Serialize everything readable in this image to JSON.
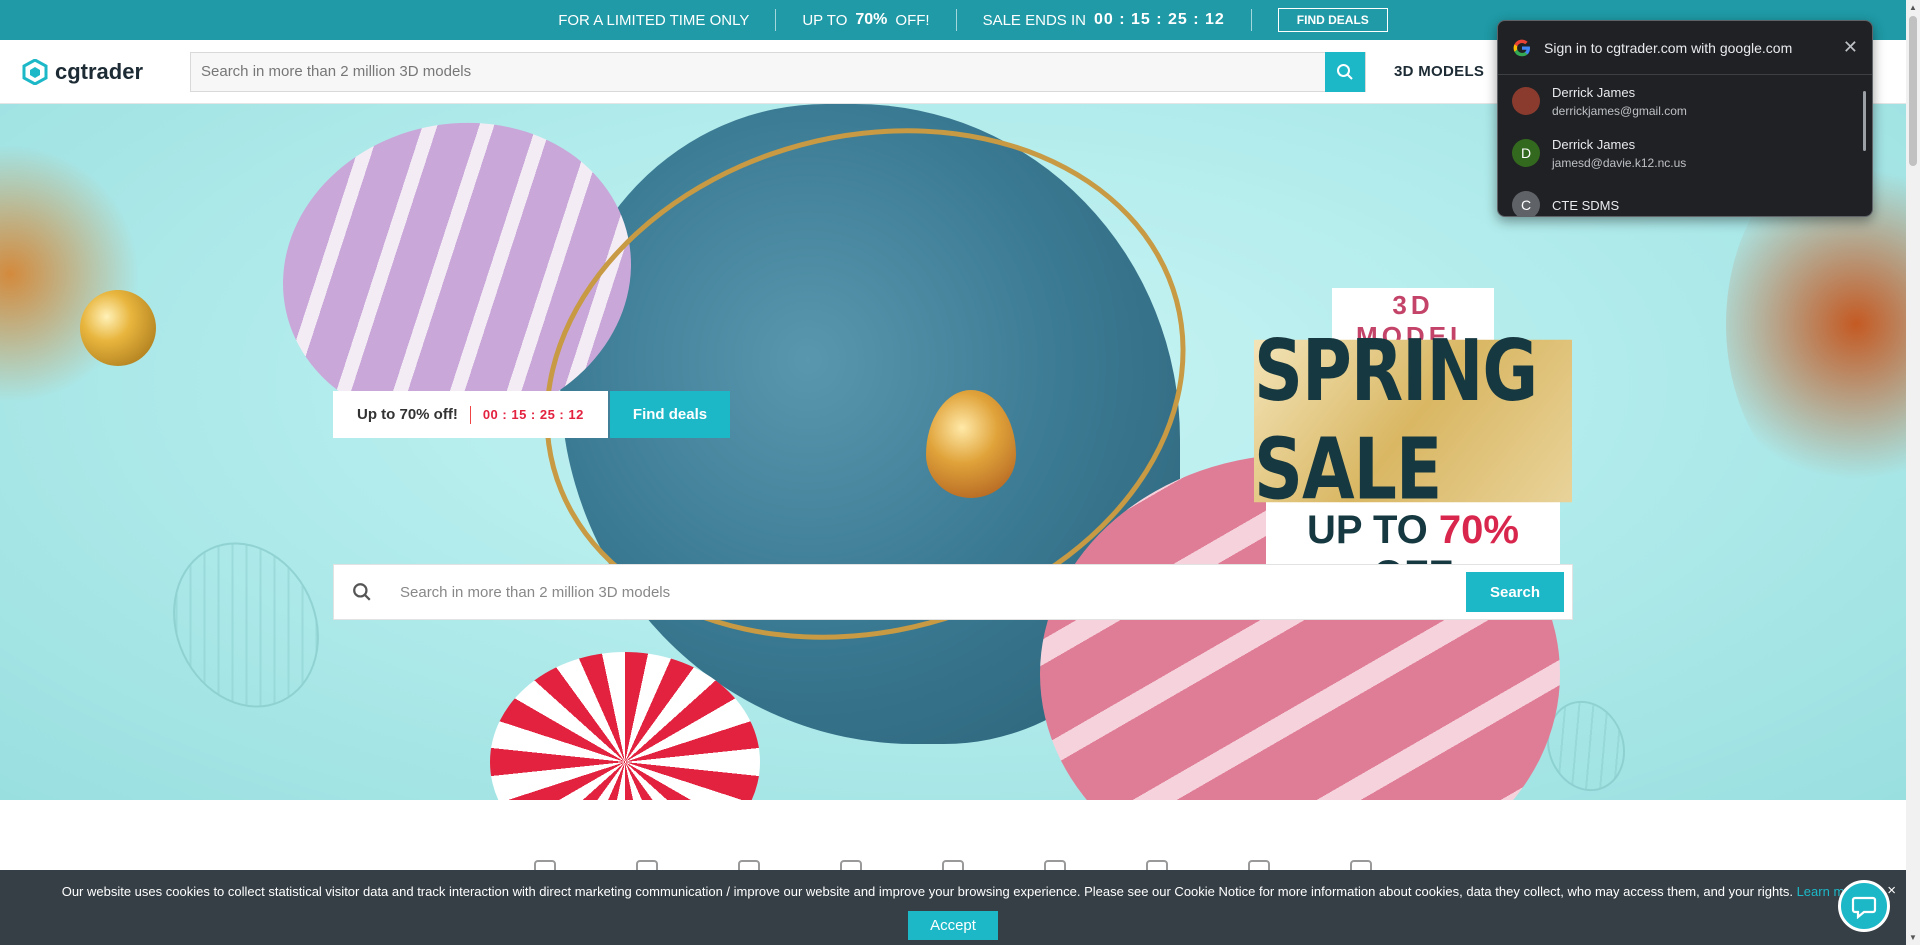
{
  "promo": {
    "limited": "FOR A LIMITED TIME ONLY",
    "upto_prefix": "UP TO",
    "upto_value": "70%",
    "upto_suffix": "OFF!",
    "sale_ends": "SALE ENDS IN",
    "timer": "00 : 15 : 25 : 12",
    "find_deals": "FIND DEALS"
  },
  "header": {
    "logo_text": "cgtrader",
    "search_placeholder": "Search in more than 2 million 3D models",
    "nav_3d_models": "3D MODELS"
  },
  "hero": {
    "pill_text": "Up to 70% off!",
    "pill_timer": "00 : 15 : 25 : 12",
    "find_deals": "Find deals",
    "sale_tag": "3D MODEL",
    "sale_title": "SPRING SALE",
    "sale_off_prefix": "UP TO ",
    "sale_off_value": "70%",
    "sale_off_suffix": " OFF",
    "search_placeholder": "Search  in more than 2 million 3D models",
    "search_button": "Search"
  },
  "cookie": {
    "message": "Our website uses cookies to collect statistical visitor data and track interaction with direct marketing communication / improve our website and improve your browsing experience. Please see our Cookie Notice for more information about cookies, data they collect, who may access them, and your rights.",
    "learn_more": "Learn m",
    "accept": "Accept",
    "close": "×"
  },
  "google_popup": {
    "title": "Sign in to cgtrader.com with google.com",
    "accounts": [
      {
        "name": "Derrick James",
        "email": "derrickjames@gmail.com",
        "avatar": "",
        "color": "#8a3b2e"
      },
      {
        "name": "Derrick James",
        "email": "jamesd@davie.k12.nc.us",
        "avatar": "D",
        "color": "#33691e"
      },
      {
        "name": "CTE SDMS",
        "email": "",
        "avatar": "C",
        "color": "#5f6368"
      }
    ]
  },
  "colors": {
    "brand": "#1cb8c7",
    "promo_bar": "#1f9aa6",
    "cookie_bar": "#363f46",
    "sale_red": "#d8264d"
  }
}
